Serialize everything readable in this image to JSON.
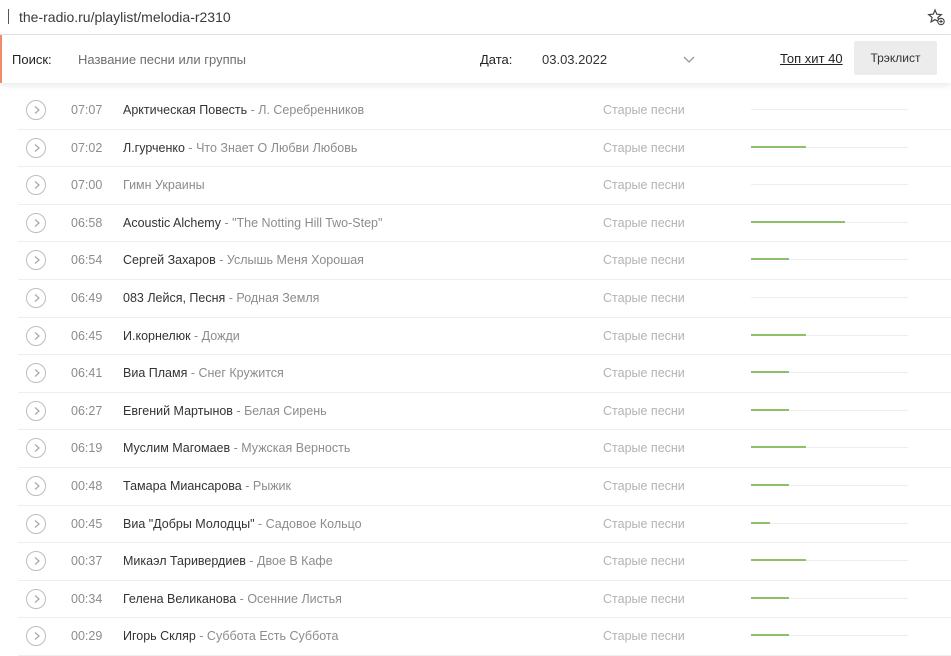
{
  "browser": {
    "url": "the-radio.ru/playlist/melodia-r2310"
  },
  "filters": {
    "search_label": "Поиск:",
    "search_placeholder": "Название песни или группы",
    "search_value": "",
    "date_label": "Дата:",
    "date_value": "03.03.2022",
    "top_link": "Топ хит 40",
    "tracklist_button": "Трэклист"
  },
  "colors": {
    "accent_bar": "#8dc06b",
    "filter_border": "#f08a6a"
  },
  "tracks": [
    {
      "time": "07:07",
      "artist": "Арктическая Повесть",
      "song": "Л. Серебренников",
      "genre": "Старые песни",
      "popularity": 0.0
    },
    {
      "time": "07:02",
      "artist": "Л.гурченко",
      "song": "Что Знает О Любви Любовь",
      "genre": "Старые песни",
      "popularity": 0.35
    },
    {
      "time": "07:00",
      "artist": "",
      "song": "Гимн Украины",
      "genre": "Старые песни",
      "popularity": 0.0
    },
    {
      "time": "06:58",
      "artist": "Acoustic Alchemy",
      "song": "\"The Notting Hill Two-Step\"",
      "genre": "Старые песни",
      "popularity": 0.6
    },
    {
      "time": "06:54",
      "artist": "Сергей Захаров",
      "song": "Услышь Меня Хорошая",
      "genre": "Старые песни",
      "popularity": 0.24
    },
    {
      "time": "06:49",
      "artist": "083 Лейся, Песня",
      "song": "Родная Земля",
      "genre": "Старые песни",
      "popularity": 0.0
    },
    {
      "time": "06:45",
      "artist": "И.корнелюк",
      "song": "Дожди",
      "genre": "Старые песни",
      "popularity": 0.35
    },
    {
      "time": "06:41",
      "artist": "Виа Пламя",
      "song": "Снег Кружится",
      "genre": "Старые песни",
      "popularity": 0.24
    },
    {
      "time": "06:27",
      "artist": "Евгений Мартынов",
      "song": "Белая Сирень",
      "genre": "Старые песни",
      "popularity": 0.24
    },
    {
      "time": "06:19",
      "artist": "Муслим Магомаев",
      "song": "Мужская Верность",
      "genre": "Старые песни",
      "popularity": 0.35
    },
    {
      "time": "00:48",
      "artist": "Тамара Миансарова",
      "song": "Рыжик",
      "genre": "Старые песни",
      "popularity": 0.24
    },
    {
      "time": "00:45",
      "artist": "Виа \"Добры Молодцы\"",
      "song": "Садовое Кольцо",
      "genre": "Старые песни",
      "popularity": 0.12
    },
    {
      "time": "00:37",
      "artist": "Микаэл Таривердиев",
      "song": "Двое В Кафе",
      "genre": "Старые песни",
      "popularity": 0.35
    },
    {
      "time": "00:34",
      "artist": "Гелена Великанова",
      "song": "Осенние Листья",
      "genre": "Старые песни",
      "popularity": 0.24
    },
    {
      "time": "00:29",
      "artist": "Игорь Скляр",
      "song": "Суббота Есть Суббота",
      "genre": "Старые песни",
      "popularity": 0.24
    }
  ]
}
